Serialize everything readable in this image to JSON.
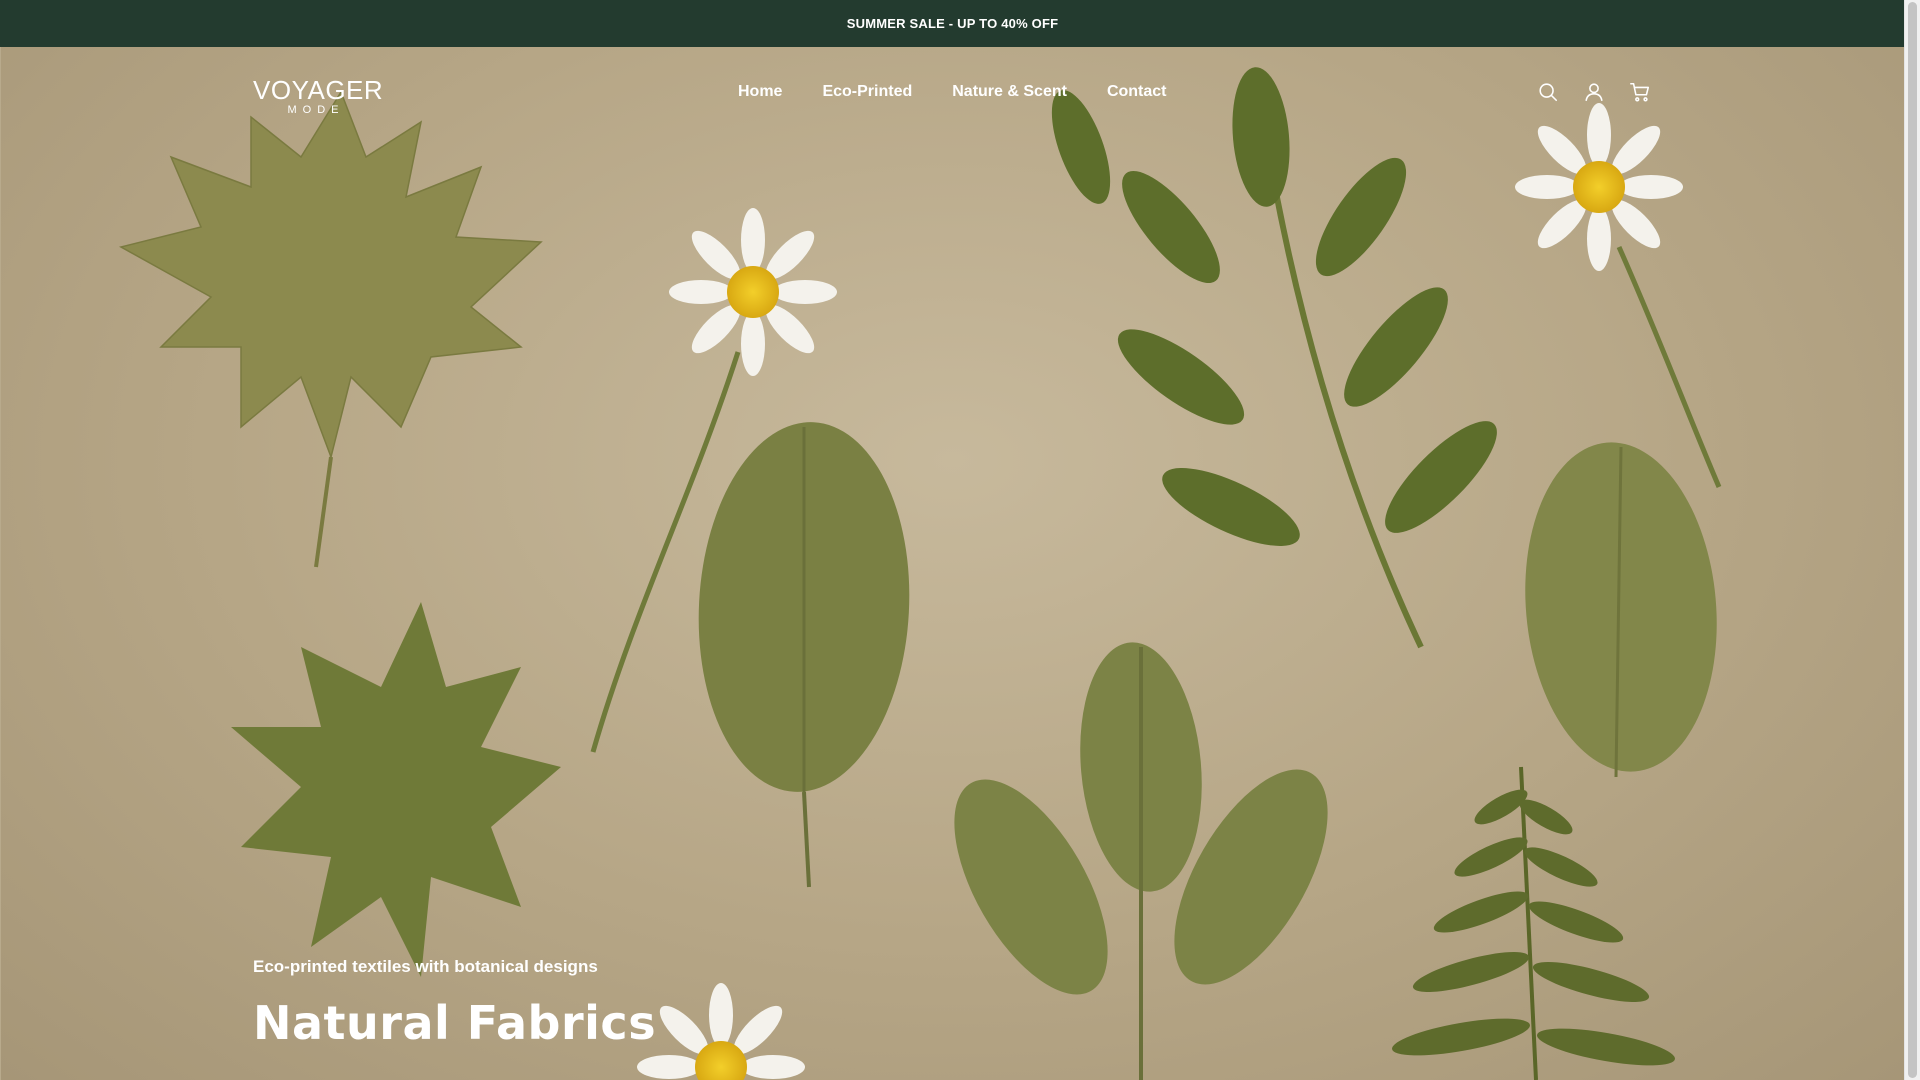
{
  "announcement": {
    "text": "SUMMER SALE - UP TO 40% OFF"
  },
  "brand": {
    "name": "VOYAGER",
    "tagline": "MODE"
  },
  "nav": {
    "items": [
      {
        "label": "Home"
      },
      {
        "label": "Eco-Printed"
      },
      {
        "label": "Nature & Scent"
      },
      {
        "label": "Contact"
      }
    ]
  },
  "header_icons": [
    "search-icon",
    "account-icon",
    "cart-icon"
  ],
  "hero": {
    "subtitle": "Eco-printed textiles with botanical designs",
    "title": "Natural Fabrics"
  },
  "colors": {
    "announcement_bg": "#233b2f",
    "hero_bg": "#b8aa8c",
    "leaf_green": "#6f7a3a",
    "text": "#ffffff"
  }
}
